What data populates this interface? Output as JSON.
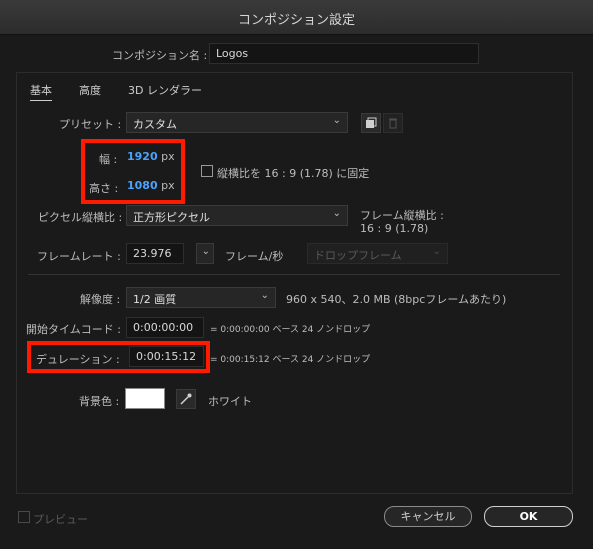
{
  "window": {
    "title": "コンポジション設定"
  },
  "comp_name": {
    "label": "コンポジション名 :",
    "value": "Logos"
  },
  "tabs": [
    {
      "label": "基本"
    },
    {
      "label": "高度"
    },
    {
      "label": "3D レンダラー"
    }
  ],
  "preset": {
    "label": "プリセット :",
    "value": "カスタム"
  },
  "width": {
    "label": "幅 :",
    "value": "1920",
    "unit": "px"
  },
  "height": {
    "label": "高さ :",
    "value": "1080",
    "unit": "px"
  },
  "lock_aspect": {
    "label": "縦横比を 16 : 9 (1.78) に固定",
    "checked": false
  },
  "pixel_aspect": {
    "label": "ピクセル縦横比 :",
    "value": "正方形ピクセル",
    "frame_aspect_label": "フレーム縦横比 :",
    "frame_aspect_value": "16 : 9 (1.78)"
  },
  "frame_rate": {
    "label": "フレームレート :",
    "value": "23.976",
    "unit": "フレーム/秒",
    "drop_frame": "ドロップフレーム"
  },
  "resolution": {
    "label": "解像度 :",
    "value": "1/2 画質",
    "info": "960 x 540、2.0 MB (8bpcフレームあたり)"
  },
  "start_timecode": {
    "label": "開始タイムコード :",
    "value": "0:00:00:00",
    "info": "= 0:00:00:00 ベース 24 ノンドロップ"
  },
  "duration": {
    "label": "デュレーション :",
    "value": "0:00:15:12",
    "info": "= 0:00:15:12 ベース 24 ノンドロップ"
  },
  "background": {
    "label": "背景色 :",
    "color_name": "ホワイト",
    "color": "#ffffff"
  },
  "footer": {
    "preview_label": "プレビュー",
    "cancel_label": "キャンセル",
    "ok_label": "OK"
  },
  "colors": {
    "highlight": "#ff1a00",
    "value_blue": "#4aa3ff"
  }
}
